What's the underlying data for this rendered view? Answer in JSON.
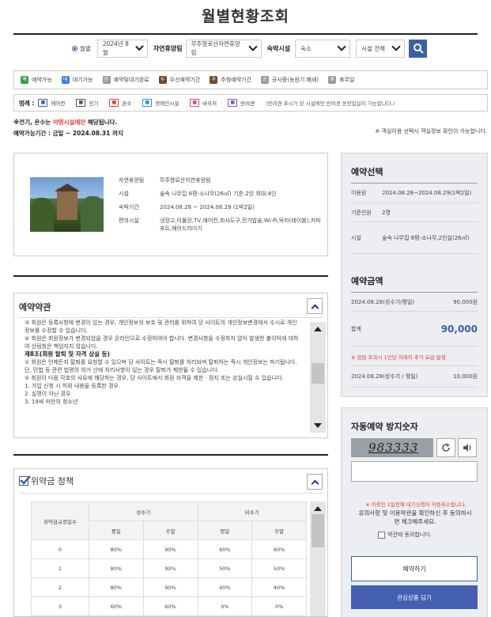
{
  "page_title": "월별현황조회",
  "search": {
    "radio_label": "월별",
    "month": "2024년 8월",
    "forest_label": "자연휴양림",
    "forest": "무주향로산자연휴양림",
    "facility_label": "숙박시설",
    "facility_type": "숙소",
    "facility": "시설 전체"
  },
  "status_legend": [
    {
      "label": "예약가능",
      "color": "#2e9f4e",
      "glyph": "예"
    },
    {
      "label": "대기가능",
      "color": "#3d7fd8",
      "glyph": "대"
    },
    {
      "label": "예약및대기완료",
      "color": "#9a9a9a",
      "glyph": "완"
    },
    {
      "label": "우선예약기간",
      "color": "#6b4a2b",
      "glyph": "우"
    },
    {
      "label": "추첨예약기간",
      "color": "#6b4a2b",
      "glyph": "추"
    },
    {
      "label": "공사중(농원기 폐쇄)",
      "color": "#9a9a9a",
      "glyph": "공"
    },
    {
      "label": "휴무일",
      "color": "#9a9a9a",
      "glyph": "휴"
    }
  ],
  "example_legend": {
    "title": "범례 :",
    "items": [
      {
        "label": "에어컨",
        "icon": "aircon-icon",
        "color": "#3d5fa8"
      },
      {
        "label": "전기",
        "icon": "electric-icon",
        "color": "#555555"
      },
      {
        "label": "온수",
        "icon": "hotwater-icon",
        "color": "#d9403a"
      },
      {
        "label": "장애인시설",
        "icon": "wheelchair-icon",
        "color": "#2f8fd8"
      },
      {
        "label": "바우처",
        "icon": "voucher-icon",
        "color": "#d94a8c"
      },
      {
        "label": "반려견",
        "icon": "pet-icon",
        "color": "#8a4fd8"
      }
    ],
    "note": "(반려견 표시가 된 시설에만 반려견 동반입실이 가능합니다.)"
  },
  "notice": {
    "prefix": "※전기, 온수는 ",
    "highlight": "야영시설에만",
    "suffix": " 해당됩니다.",
    "period": "예약가능기간 : 금일 ~ 2024.08.31 까지",
    "right": "※ 객실이용 선택시 객실정보 확인이 가능합니다."
  },
  "facility_info": {
    "rows": [
      {
        "key": "자연휴양림",
        "value": "무주향로산자연휴양림"
      },
      {
        "key": "시설",
        "value": "숲속 나무집 8평-소나무(26㎡) 기준:2인 최대:4인"
      },
      {
        "key": "숙박기간",
        "value": "2024.08.28 ~ 2024.08.29 (1박2일)"
      },
      {
        "key": "편의시설",
        "value": "냉장고,이불장,TV,에어컨,취사도구,전기밥솥,Wi-Fi,탁자(테이블),커피포트,헤어드라이기"
      }
    ]
  },
  "terms": {
    "title": "예약약관",
    "lines": [
      "③ 회원은 등록사항에 변경이 있는 경우, 개인정보의 보호 및 관리를 위하여 당 사이트의 개인정보변경에서 수시로 개인정보를 수정할 수 있습니다.",
      "④ 회원은 회원정보가 변경되었을 경우 온라인으로 수정하여야 합니다. 변경사항을 수정하지 않아 발생한 불이익에 대하여 산림청은 책임지지 않습니다.",
      "제8조(회원 탈퇴 및 자격 상실 등)",
      "① 회원은 언제든지 탈퇴를 요청할 수 있으며 당 사이트는 즉시 탈퇴를 처리되며 탈퇴하는 즉시 개인정보는 파기됩니다. 단, 민법 등 관련 법령의 의거 산에 처리사항이 있는 경우 탈퇴가 제한될 수 있습니다.",
      "② 회원이 다음 각호의 사유에 해당하는 경우, 당 사이트에서 회원 자격을 제한 · 정지 또는 상실시킬 수 있습니다.",
      "1. 가입 신청 시 허위 내용을 등록한 경우",
      "2. 실명이 아닌 경우",
      "3. 19세 미만의 청소년"
    ]
  },
  "penalty": {
    "title": "위약금 정책",
    "headers": {
      "days": "위약금규정일수",
      "peak": "성수기",
      "off": "비수기",
      "weekday": "평일",
      "weekend": "주말"
    },
    "rows": [
      {
        "day": "0",
        "v": [
          "80%",
          "90%",
          "60%",
          "60%"
        ]
      },
      {
        "day": "1",
        "v": [
          "80%",
          "90%",
          "50%",
          "50%"
        ]
      },
      {
        "day": "2",
        "v": [
          "80%",
          "90%",
          "40%",
          "40%"
        ]
      },
      {
        "day": "3",
        "v": [
          "60%",
          "60%",
          "0%",
          "0%"
        ]
      }
    ]
  },
  "reservation": {
    "title": "예약선택",
    "user_key": "이용원",
    "user_val": "2024.08.28~2024.08.29(1박2일)",
    "base_key": "기준인원",
    "base_val": "2명",
    "fac_key": "시설",
    "fac_val": "숲속 나무집 8평-소나무,2인실(26㎡)",
    "amount_title": "예약금액",
    "amount_row_key": "2024.08.28(성수기/평일)",
    "amount_row_val": "90,000원",
    "total_key": "합계",
    "total_val": "90,000",
    "extra_note": "※ 정원 초과시 1인당 아래의 추가 요금 발생",
    "extra_key": "2024.08.28(성수기 / 평일)",
    "extra_val": "10,000원"
  },
  "captcha": {
    "title": "자동예약 방지숫자",
    "code": "983333",
    "input_placeholder": "",
    "warning": "※ 이용인 2일전에 대기신청이 자동취소됩니다.",
    "confirm": "유의사항 및 이용약관을 확인하신 후 동의하시면 체크해주세요.",
    "agree": "약관에 동의합니다.",
    "reserve_btn": "예약하기",
    "wish_btn": "관심상품 담기"
  }
}
